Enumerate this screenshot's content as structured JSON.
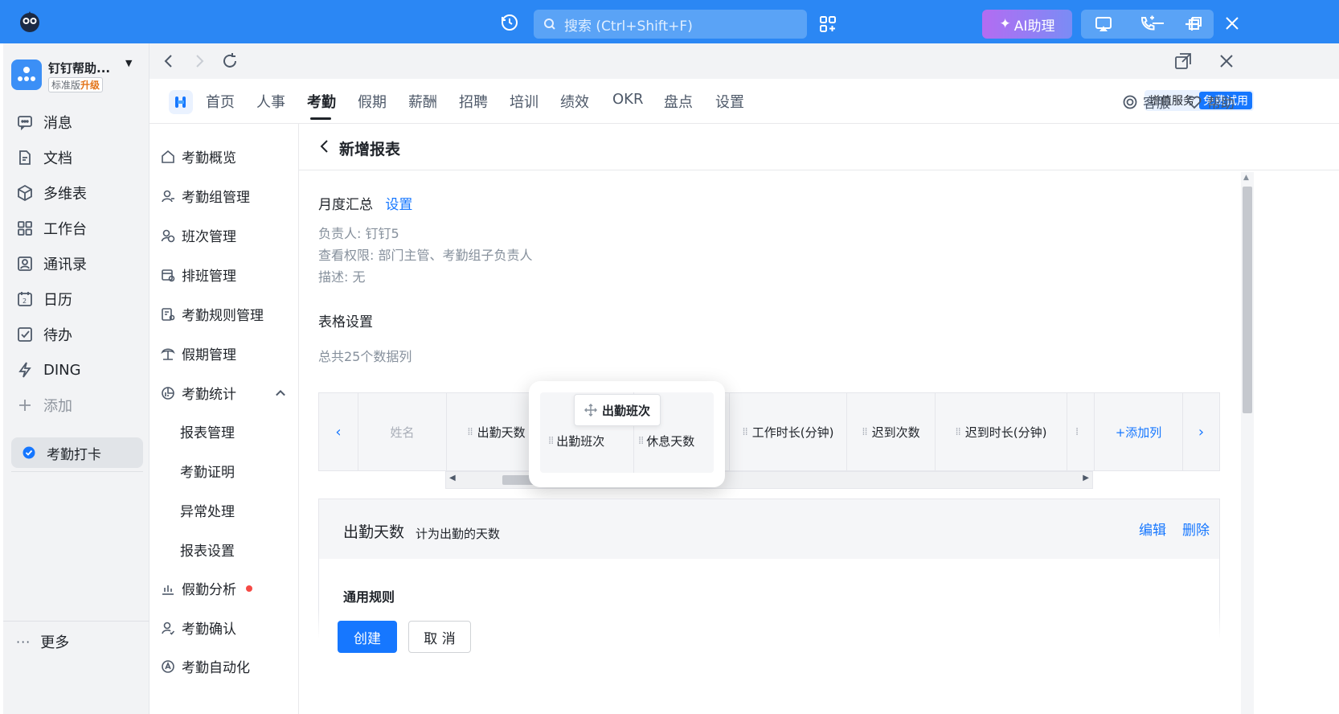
{
  "titlebar": {
    "search_placeholder": "搜索 (Ctrl+Shift+F)",
    "ai_label": "AI助理"
  },
  "org": {
    "name": "钉钉帮助...",
    "badge": "标准版",
    "upgrade": "升级"
  },
  "rail": {
    "items": [
      {
        "label": "消息",
        "icon": "message-icon"
      },
      {
        "label": "文档",
        "icon": "document-icon"
      },
      {
        "label": "多维表",
        "icon": "cube-icon"
      },
      {
        "label": "工作台",
        "icon": "grid-icon"
      },
      {
        "label": "通讯录",
        "icon": "contacts-icon"
      },
      {
        "label": "日历",
        "icon": "calendar-icon"
      },
      {
        "label": "待办",
        "icon": "todo-icon"
      },
      {
        "label": "DING",
        "icon": "bolt-icon"
      },
      {
        "label": "添加",
        "icon": "plus-icon"
      }
    ],
    "active": "考勤打卡",
    "more": "更多"
  },
  "menu": {
    "items": [
      "首页",
      "人事",
      "考勤",
      "假期",
      "薪酬",
      "招聘",
      "培训",
      "绩效",
      "OKR",
      "盘点",
      "设置"
    ],
    "active": "考勤",
    "vas_label": "增值服务",
    "trial_label": "免费试用",
    "service": "客服",
    "help": "帮助"
  },
  "subnav": {
    "items": [
      "考勤概览",
      "考勤组管理",
      "班次管理",
      "排班管理",
      "考勤规则管理",
      "假期管理",
      "考勤统计"
    ],
    "children": [
      "报表管理",
      "考勤证明",
      "异常处理",
      "报表设置"
    ],
    "after": [
      "假勤分析",
      "考勤确认",
      "考勤自动化"
    ]
  },
  "page": {
    "title": "新增报表",
    "report_type": "月度汇总",
    "settings_link": "设置",
    "owner": "负责人: 钉钉5",
    "permission": "查看权限: 部门主管、考勤组子负责人",
    "description": "描述: 无",
    "table_settings": "表格设置",
    "column_count": "总共25个数据列"
  },
  "columns": {
    "name": "姓名",
    "items": [
      "出勤天数",
      "工作时长(分钟)",
      "迟到次数",
      "迟到时长(分钟)"
    ],
    "add": "+添加列"
  },
  "drag": {
    "chip": "出勤班次",
    "cell_left": "出勤班次",
    "cell_right": "休息天数"
  },
  "detail": {
    "title": "出勤天数",
    "subtitle": "计为出勤的天数",
    "edit": "编辑",
    "delete": "删除",
    "rule_title": "通用规则"
  },
  "footer": {
    "create": "创建",
    "cancel": "取 消"
  },
  "colors": {
    "titlebar": "#2b87f4",
    "accent": "#1677ff",
    "dot": "#f54a45"
  }
}
